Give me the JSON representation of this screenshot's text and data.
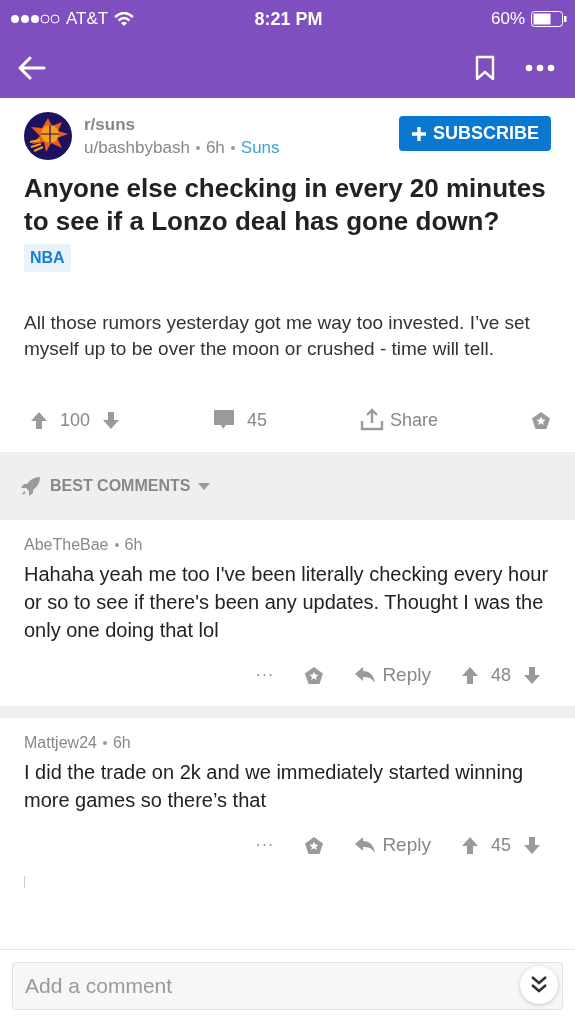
{
  "status_bar": {
    "carrier": "AT&T",
    "time": "8:21 PM",
    "battery": "60%"
  },
  "post": {
    "subreddit": "r/suns",
    "author": "u/bashbybash",
    "age": "6h",
    "flair": "Suns",
    "subscribe": "SUBSCRIBE",
    "title": "Anyone else checking in every 20 minutes to see if a Lonzo deal has gone down?",
    "tag": "NBA",
    "body": "All those rumors yesterday got me way too invested. I’ve set myself up to be over the moon or crushed - time will tell.",
    "score": "100",
    "comments": "45",
    "share": "Share"
  },
  "sort": {
    "label": "BEST COMMENTS"
  },
  "comments": [
    {
      "author": "AbeTheBae",
      "age": "6h",
      "text": "Hahaha yeah me too I've been literally checking every hour or so to see if there's been any updates. Thought I was the only one doing that lol",
      "more": "···",
      "reply": "Reply",
      "score": "48"
    },
    {
      "author": "Mattjew24",
      "age": "6h",
      "text": "I did the trade on 2k and we immediately started winning more games so there’s that",
      "more": "···",
      "reply": "Reply",
      "score": "45"
    }
  ],
  "composer": {
    "placeholder": "Add a comment"
  }
}
